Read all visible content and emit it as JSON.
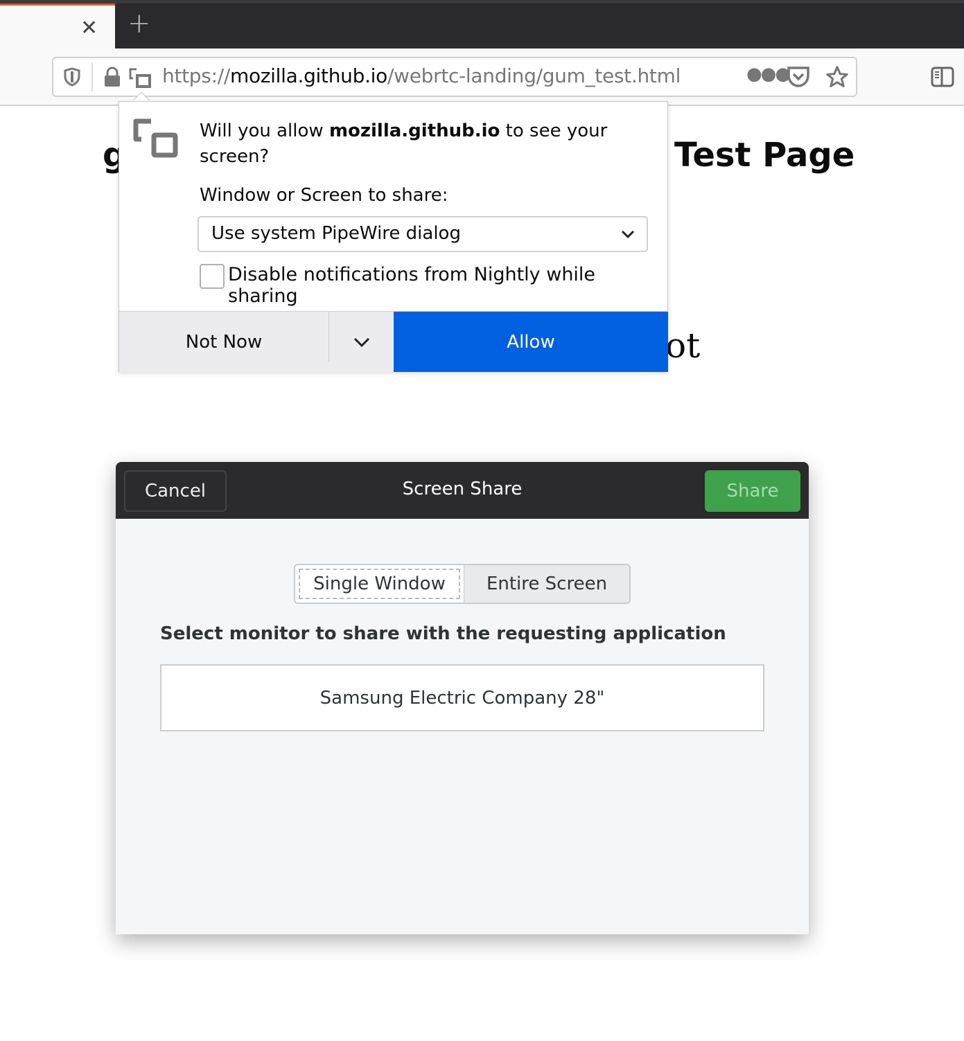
{
  "browser": {
    "url_scheme": "https://",
    "url_host": "mozilla.github.io",
    "url_path": "/webrtc-landing/gum_test.html",
    "icons": [
      "close-icon",
      "plus-icon",
      "shield-icon",
      "lock-icon",
      "screen-share-icon",
      "more-icon",
      "pocket-icon",
      "star-icon",
      "sidebar-icon"
    ]
  },
  "page": {
    "heading_left": "g",
    "heading_right": "Test Page",
    "text_fragment": "ot"
  },
  "popup": {
    "msg_pre": "Will you allow ",
    "msg_host": "mozilla.github.io",
    "msg_post": " to see your screen?",
    "share_label": "Window or Screen to share:",
    "select_value": "Use system PipeWire dialog",
    "checkbox_label": "Disable notifications from Nightly while sharing",
    "checkbox_checked": false,
    "not_now": "Not Now",
    "allow": "Allow",
    "allow_color": "#0060df"
  },
  "dialog": {
    "cancel": "Cancel",
    "title": "Screen Share",
    "share": "Share",
    "share_color": "#3ea24b",
    "tabs": [
      "Single Window",
      "Entire Screen"
    ],
    "selected_tab": "Single Window",
    "prompt": "Select monitor to share with the requesting application",
    "monitors": [
      "Samsung Electric Company 28\""
    ]
  }
}
